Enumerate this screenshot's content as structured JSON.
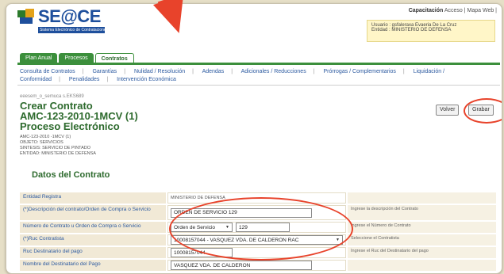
{
  "header": {
    "logo_text": "SE@CE",
    "logo_sub": "Sistema Electrónico de Contrataciones",
    "topbar_bold": "Capacitación",
    "topbar_rest": " Acceso | Mapa Web |",
    "user_line1": "Usuario : gsfaleraxa Evaeria De La Cruz",
    "user_line2": "Entidad : MINISTERIO DE DEFENSA"
  },
  "tabs": [
    "Plan Anual",
    "Procesos",
    "Contratos"
  ],
  "menu": {
    "items": [
      "Consulta de Contratos",
      "Garantías",
      "Nulidad / Resolución",
      "Adendas",
      "Adicionales / Reducciones",
      "Prórrogas / Complementarios",
      "Liquidación /",
      "Conformidad",
      "Penalidades",
      "Intervención Económica"
    ]
  },
  "main": {
    "breadcrumb": "eeesem_o_semuca s.EKS689",
    "title_line1": "Crear Contrato",
    "title_line2": "AMC-123-2010-1MCV (1)",
    "title_line3": "Proceso Electrónico",
    "info_lines": [
      "AMC-123-2010 -1MCV (1)",
      "OBJETO: SERVICIOS",
      "SINTESIS: SERVICIO DE PINTADO",
      "ENTIDAD: MINISTERIO DE DEFENSA"
    ],
    "back_button": "Volver",
    "save_button": "Grabar",
    "section_title": "Datos del Contrato"
  },
  "form": {
    "rows": [
      {
        "label": "Entidad Registra",
        "value": "MINISTERIO DE DEFENSA",
        "hint": ""
      },
      {
        "label": "(*)Descripción del contrato/Orden de Compra o Servicio",
        "value": "ORDEN DE SERVICIO 129",
        "hint": "Ingrese la descripción del Contrato"
      },
      {
        "label": "Número de Contrato u Orden de Compra o Servicio",
        "select": "Orden de Servicio",
        "value": "129",
        "hint": "Ingrese el Número de Contrato"
      },
      {
        "label": "(*)Ruc Contratista",
        "select": "10008157044 - VASQUEZ VDA. DE CALDERON RAC",
        "hint": "Seleccione el Contratista"
      },
      {
        "label": "Ruc Destinatario del pago",
        "value": "10008157044",
        "hint": "Ingrese el Ruc del Destinatario del pago"
      },
      {
        "label": "Nombre del Destinatario del Pago",
        "value": "VASQUEZ VDA. DE CALDERON",
        "hint": ""
      }
    ]
  },
  "colors": {
    "accent_green": "#3c8f3c",
    "link_blue": "#2c5aa0",
    "annotation_red": "#e8432b"
  }
}
